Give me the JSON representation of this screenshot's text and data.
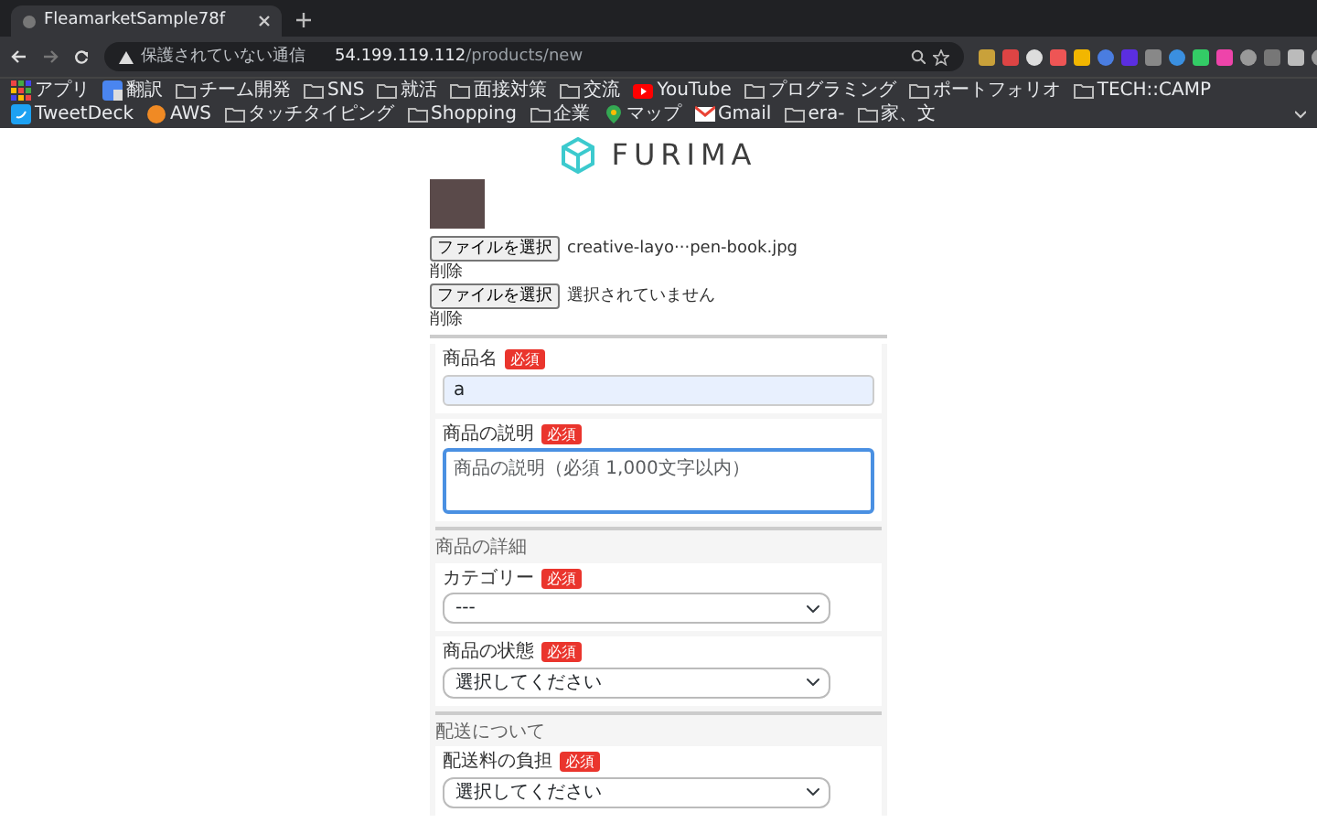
{
  "browser": {
    "tab_title": "FleamarketSample78f",
    "url_warning": "保護されていない通信",
    "url_host": "54.199.119.112",
    "url_path": "/products/new",
    "bookmarks": [
      {
        "label": "アプリ",
        "kind": "apps"
      },
      {
        "label": "翻訳",
        "kind": "translate"
      },
      {
        "label": "チーム開発",
        "kind": "folder"
      },
      {
        "label": "SNS",
        "kind": "folder"
      },
      {
        "label": "就活",
        "kind": "folder"
      },
      {
        "label": "面接対策",
        "kind": "folder"
      },
      {
        "label": "交流",
        "kind": "folder"
      },
      {
        "label": "YouTube",
        "kind": "youtube"
      },
      {
        "label": "プログラミング",
        "kind": "folder"
      },
      {
        "label": "ポートフォリオ",
        "kind": "folder"
      },
      {
        "label": "TECH::CAMP",
        "kind": "folder"
      },
      {
        "label": "TweetDeck",
        "kind": "twitter"
      },
      {
        "label": "AWS",
        "kind": "aws"
      },
      {
        "label": "タッチタイピング",
        "kind": "folder"
      },
      {
        "label": "Shopping",
        "kind": "folder"
      },
      {
        "label": "企業",
        "kind": "folder"
      },
      {
        "label": "マップ",
        "kind": "maps"
      },
      {
        "label": "Gmail",
        "kind": "gmail"
      },
      {
        "label": "era-",
        "kind": "folder"
      },
      {
        "label": "家、文",
        "kind": "folder"
      }
    ]
  },
  "logo": {
    "text": "FURIMA"
  },
  "file_inputs": [
    {
      "button": "ファイルを選択",
      "filename": "creative-layo···pen-book.jpg",
      "delete": "削除"
    },
    {
      "button": "ファイルを選択",
      "filename": "選択されていません",
      "delete": "削除"
    }
  ],
  "form": [
    {
      "kind": "card",
      "label": "商品名",
      "badge": "必須",
      "field": {
        "kind": "text",
        "value": "a",
        "autofilled": true
      }
    },
    {
      "kind": "card",
      "label": "商品の説明",
      "badge": "必須",
      "field": {
        "kind": "textarea",
        "placeholder": "商品の説明（必須 1,000文字以内）",
        "focused": true
      }
    },
    {
      "kind": "heading",
      "label": "商品の詳細"
    },
    {
      "kind": "card",
      "label": "カテゴリー",
      "badge": "必須",
      "field": {
        "kind": "select",
        "value": "---"
      }
    },
    {
      "kind": "card",
      "label": "商品の状態",
      "badge": "必須",
      "field": {
        "kind": "select",
        "value": "選択してください"
      }
    },
    {
      "kind": "heading",
      "label": "配送について"
    },
    {
      "kind": "card",
      "label": "配送料の負担",
      "badge": "必須",
      "field": {
        "kind": "select",
        "value": "選択してください"
      }
    }
  ]
}
